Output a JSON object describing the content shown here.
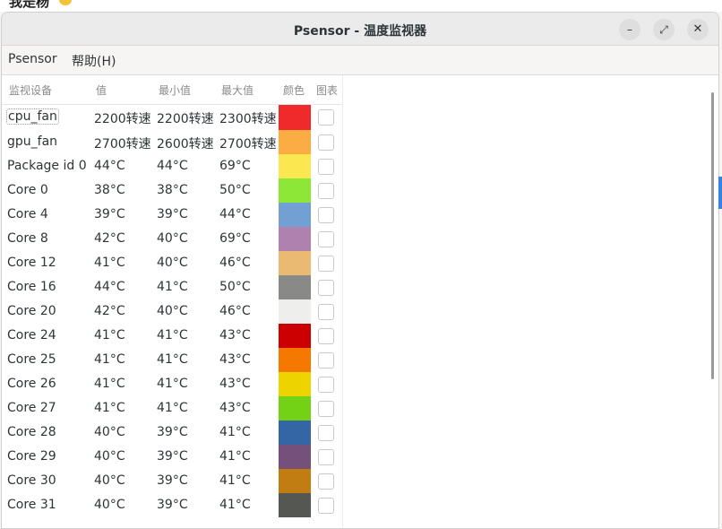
{
  "desktop": {
    "top_text": "我是杨"
  },
  "window": {
    "title": "Psensor - 温度监视器",
    "buttons": {
      "minimize": "–",
      "maximize": "⤢",
      "close": "✕"
    }
  },
  "menu": {
    "items": [
      "Psensor",
      "帮助(H)"
    ]
  },
  "table": {
    "headers": {
      "name": "监视设备",
      "value": "值",
      "min": "最小值",
      "max": "最大值",
      "color": "颜色",
      "chart": "图表"
    },
    "rows": [
      {
        "name": "cpu_fan",
        "value": "2200转速",
        "min": "2200转速",
        "max": "2300转速",
        "color": "#f0292b"
      },
      {
        "name": "gpu_fan",
        "value": "2700转速",
        "min": "2600转速",
        "max": "2700转速",
        "color": "#fbad44"
      },
      {
        "name": "Package id 0",
        "value": "44°C",
        "min": "44°C",
        "max": "69°C",
        "color": "#fbe851"
      },
      {
        "name": "Core 0",
        "value": "38°C",
        "min": "38°C",
        "max": "50°C",
        "color": "#8ce737"
      },
      {
        "name": "Core 4",
        "value": "39°C",
        "min": "39°C",
        "max": "44°C",
        "color": "#73a0d2"
      },
      {
        "name": "Core 8",
        "value": "42°C",
        "min": "40°C",
        "max": "69°C",
        "color": "#ae81af"
      },
      {
        "name": "Core 12",
        "value": "41°C",
        "min": "40°C",
        "max": "46°C",
        "color": "#ebba72"
      },
      {
        "name": "Core 16",
        "value": "44°C",
        "min": "41°C",
        "max": "50°C",
        "color": "#898a87"
      },
      {
        "name": "Core 20",
        "value": "42°C",
        "min": "40°C",
        "max": "46°C",
        "color": "#eeeeec"
      },
      {
        "name": "Core 24",
        "value": "41°C",
        "min": "41°C",
        "max": "43°C",
        "color": "#cc0000"
      },
      {
        "name": "Core 25",
        "value": "41°C",
        "min": "41°C",
        "max": "43°C",
        "color": "#f57900"
      },
      {
        "name": "Core 26",
        "value": "41°C",
        "min": "41°C",
        "max": "43°C",
        "color": "#edd400"
      },
      {
        "name": "Core 27",
        "value": "41°C",
        "min": "41°C",
        "max": "43°C",
        "color": "#73d216"
      },
      {
        "name": "Core 28",
        "value": "40°C",
        "min": "39°C",
        "max": "41°C",
        "color": "#3465a4"
      },
      {
        "name": "Core 29",
        "value": "40°C",
        "min": "39°C",
        "max": "41°C",
        "color": "#75507b"
      },
      {
        "name": "Core 30",
        "value": "40°C",
        "min": "39°C",
        "max": "41°C",
        "color": "#c17d11"
      },
      {
        "name": "Core 31",
        "value": "40°C",
        "min": "39°C",
        "max": "41°C",
        "color": "#555753"
      }
    ]
  }
}
